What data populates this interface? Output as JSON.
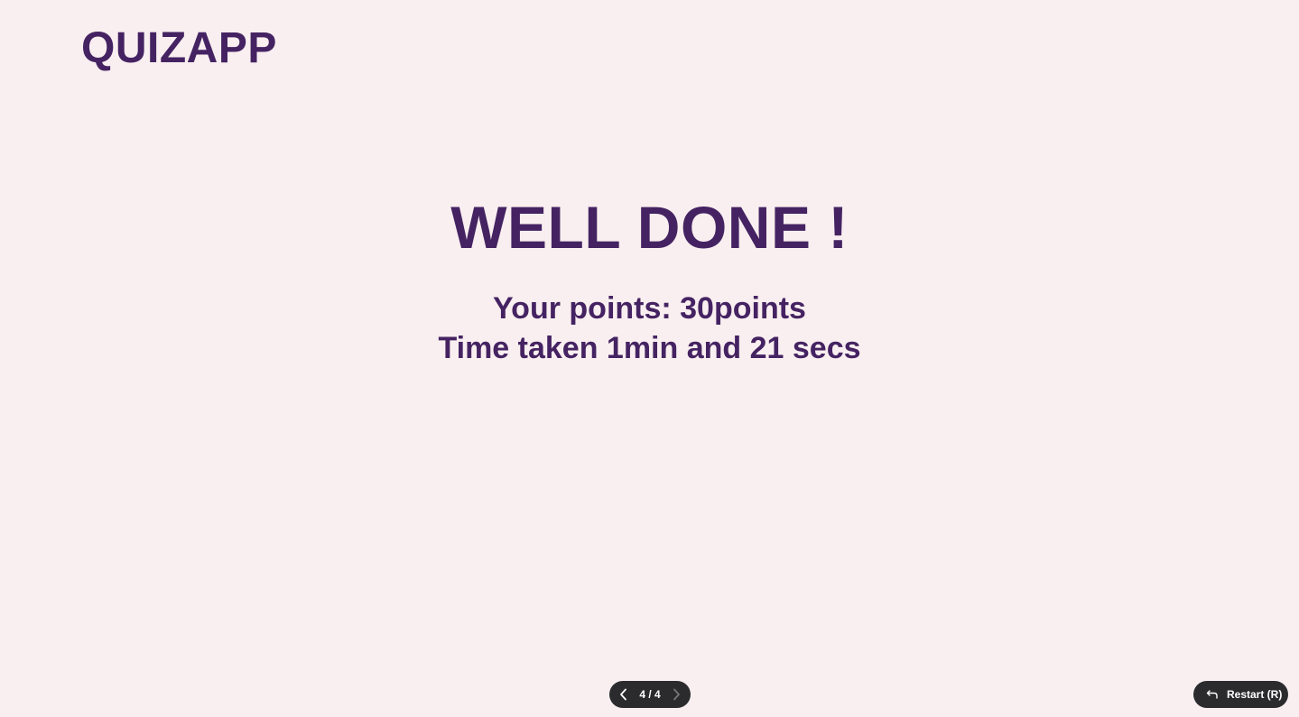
{
  "app": {
    "logo": "QUIZAPP"
  },
  "result": {
    "headline": "WELL DONE !",
    "points_line": "Your points: 30points",
    "time_line": "Time taken 1min and 21 secs"
  },
  "pager": {
    "count": "4 / 4",
    "prev_icon": "chevron-left-icon",
    "next_icon": "chevron-right-icon"
  },
  "restart": {
    "label": "Restart (R)",
    "icon": "return-arrow-icon"
  },
  "colors": {
    "background": "#f9eff0",
    "primary": "#452362",
    "control_bg": "#2b2b2e",
    "control_text": "#ffffff"
  }
}
